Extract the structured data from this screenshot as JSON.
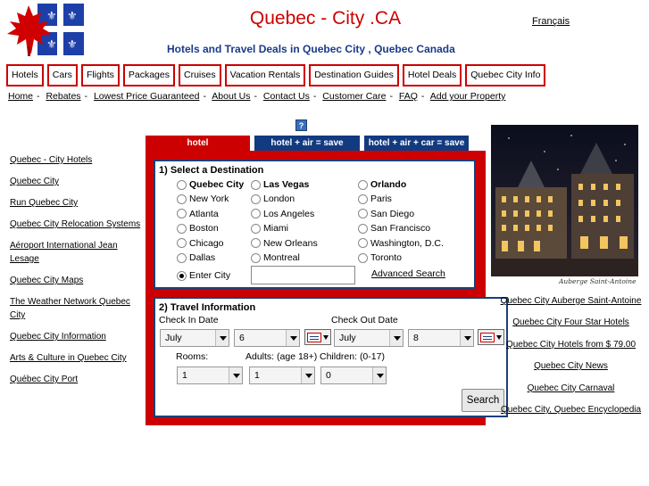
{
  "header": {
    "title": "Quebec - City .CA",
    "language_link": "Français",
    "tagline": "Hotels and Travel Deals in Quebec City , Quebec Canada"
  },
  "nav": {
    "items": [
      "Hotels",
      "Cars",
      "Flights",
      "Packages",
      "Cruises",
      "Vacation Rentals",
      "Destination Guides",
      "Hotel Deals",
      "Quebec City Info"
    ]
  },
  "toplinks": [
    "Home",
    "Rebates",
    "Lowest Price Guaranteed",
    "About Us",
    "Contact Us",
    "Customer Care",
    "FAQ",
    "Add your Property"
  ],
  "sidebar": {
    "links": [
      "Quebec - City Hotels",
      "Quebec City",
      "Run Quebec City",
      "Quebec City Relocation Systems",
      "Aéroport International Jean Lesage",
      "Quebec City Maps",
      "The Weather Network Quebec City",
      "Quebec City Information",
      "Arts & Culture in Quebec City",
      "Québec City Port"
    ]
  },
  "help_icon": "?",
  "tabs": [
    "hotel",
    "hotel + air = save",
    "hotel + air + car = save"
  ],
  "destination": {
    "heading": "1) Select a Destination",
    "cities": [
      {
        "label": "Quebec City",
        "bold": true
      },
      {
        "label": "Las Vegas",
        "bold": true
      },
      {
        "label": "Orlando",
        "bold": true
      },
      {
        "label": "New York",
        "bold": false
      },
      {
        "label": "London",
        "bold": false
      },
      {
        "label": "Paris",
        "bold": false
      },
      {
        "label": "Atlanta",
        "bold": false
      },
      {
        "label": "Los Angeles",
        "bold": false
      },
      {
        "label": "San Diego",
        "bold": false
      },
      {
        "label": "Boston",
        "bold": false
      },
      {
        "label": "Miami",
        "bold": false
      },
      {
        "label": "San Francisco",
        "bold": false
      },
      {
        "label": "Chicago",
        "bold": false
      },
      {
        "label": "New Orleans",
        "bold": false
      },
      {
        "label": "Washington, D.C.",
        "bold": false
      },
      {
        "label": "Dallas",
        "bold": false
      },
      {
        "label": "Montreal",
        "bold": false
      },
      {
        "label": "Toronto",
        "bold": false
      }
    ],
    "enter_city_label": "Enter City",
    "enter_city_selected": true,
    "city_input_value": "",
    "advanced_search": "Advanced Search"
  },
  "travel": {
    "heading": "2) Travel Information",
    "check_in_label": "Check In Date",
    "check_out_label": "Check Out Date",
    "check_in_month": "July",
    "check_in_day": "6",
    "check_out_month": "July",
    "check_out_day": "8",
    "rooms_label": "Rooms:",
    "adults_label": "Adults: (age 18+)",
    "children_label": "Children: (0-17)",
    "rooms_value": "1",
    "adults_value": "1",
    "children_value": "0",
    "search_button": "Search"
  },
  "photo": {
    "caption": "Auberge Saint-Antoine"
  },
  "right_links": [
    "Quebec City Auberge Saint-Antoine",
    "Quebec City Four Star Hotels",
    "Quebec City Hotels from $ 79.00",
    "Quebec City News",
    "Quebec City Carnaval",
    "Quebec City, Quebec Encyclopedia"
  ],
  "colors": {
    "brand_red": "#cc0000",
    "tagline_blue": "#1a3a8a",
    "tab_blue": "#123a80",
    "box_border": "#1d3f78"
  }
}
